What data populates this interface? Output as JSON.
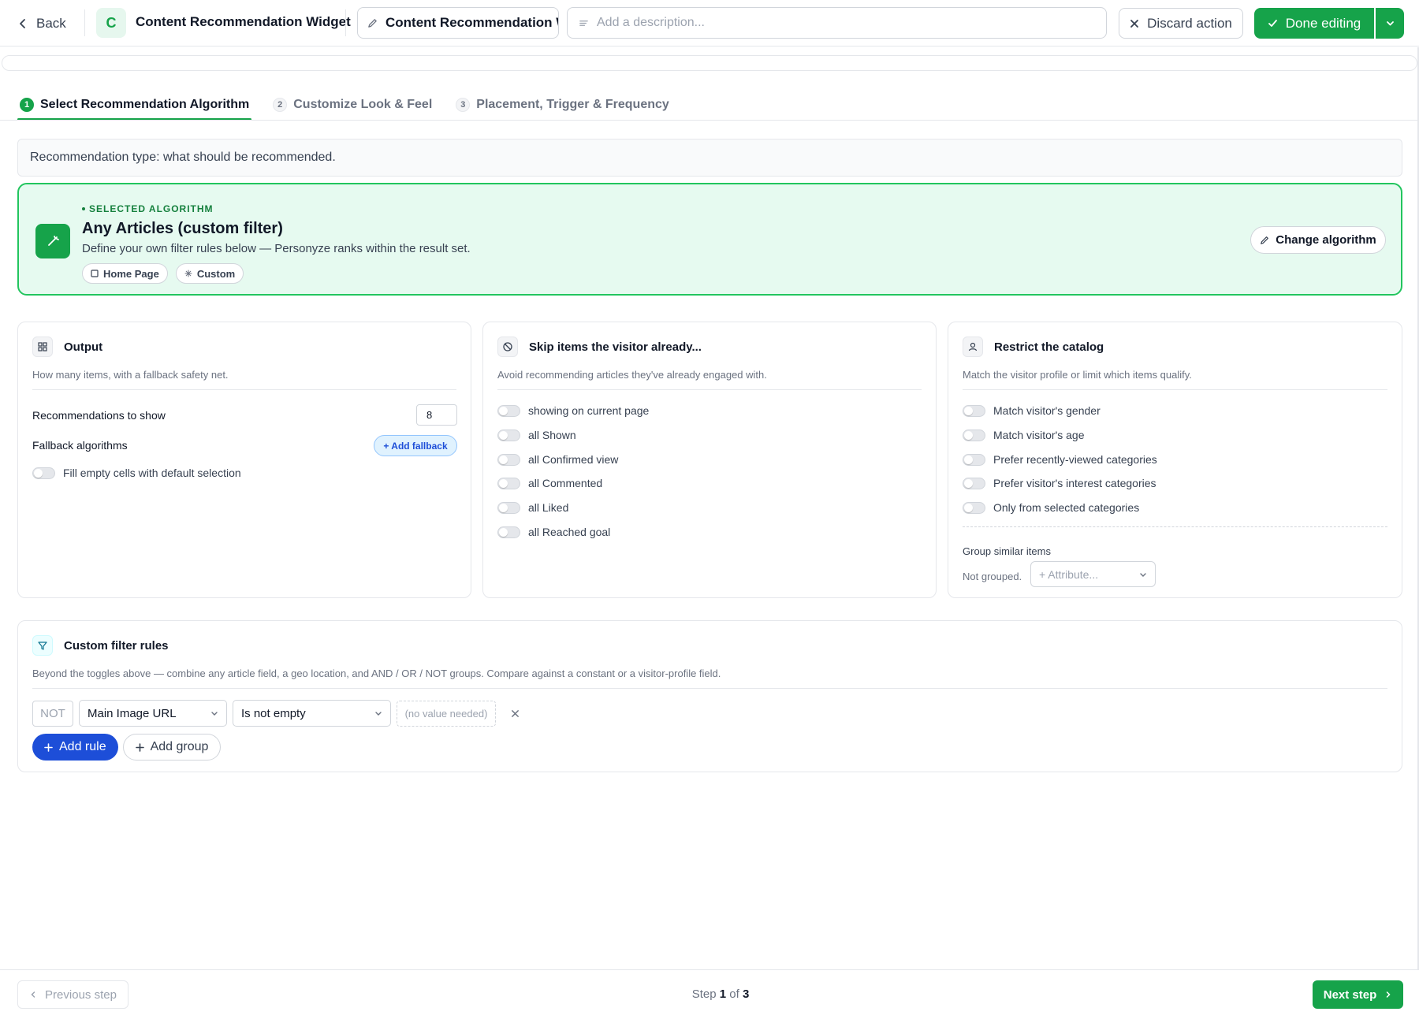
{
  "header": {
    "back_label": "Back",
    "avatar_letter": "C",
    "title": "Content Recommendation Widget",
    "name_value": "Content Recommendation W",
    "description_placeholder": "Add a description...",
    "discard_label": "Discard action",
    "done_label": "Done editing"
  },
  "steps": [
    {
      "num": "1",
      "label": "Select Recommendation Algorithm",
      "active": true
    },
    {
      "num": "2",
      "label": "Customize Look & Feel",
      "active": false
    },
    {
      "num": "3",
      "label": "Placement, Trigger & Frequency",
      "active": false
    }
  ],
  "info_text": "Recommendation type: what should be recommended.",
  "algorithm": {
    "kicker": "SELECTED ALGORITHM",
    "title": "Any Articles (custom filter)",
    "subtitle": "Define your own filter rules below — Personyze ranks within the result set.",
    "tags": [
      "Home Page",
      "Custom"
    ],
    "change_label": "Change algorithm"
  },
  "output": {
    "title": "Output",
    "subtitle": "How many items, with a fallback safety net.",
    "count_label": "Recommendations to show",
    "count_value": "8",
    "fallback_label": "Fallback algorithms",
    "add_fallback_label": "+ Add fallback",
    "fill_label": "Fill empty cells with default selection"
  },
  "skip": {
    "title": "Skip items the visitor already...",
    "subtitle": "Avoid recommending articles they've already engaged with.",
    "items": [
      "showing on current page",
      "all Shown",
      "all Confirmed view",
      "all Commented",
      "all Liked",
      "all Reached goal"
    ]
  },
  "restrict": {
    "title": "Restrict the catalog",
    "subtitle": "Match the visitor profile or limit which items qualify.",
    "items": [
      "Match visitor's gender",
      "Match visitor's age",
      "Prefer recently-viewed categories",
      "Prefer visitor's interest categories",
      "Only from selected categories"
    ],
    "group_label": "Group similar items",
    "group_note": "Not grouped.",
    "attribute_placeholder": "+ Attribute..."
  },
  "rules": {
    "title": "Custom filter rules",
    "subtitle": "Beyond the toggles above — combine any article field, a geo location, and AND / OR / NOT groups. Compare against a constant or a visitor-profile field.",
    "not_label": "NOT",
    "field_value": "Main Image URL",
    "operator_value": "Is not empty",
    "value_placeholder": "(no value needed)",
    "add_rule_label": "Add rule",
    "add_group_label": "Add group"
  },
  "footer": {
    "prev_label": "Previous step",
    "step_prefix": "Step",
    "step_current": "1",
    "step_of": "of",
    "step_total": "3",
    "next_label": "Next step"
  },
  "colors": {
    "accent": "#16a34a",
    "primary_blue": "#1d4ed8",
    "algo_bg": "#e6faf0"
  }
}
